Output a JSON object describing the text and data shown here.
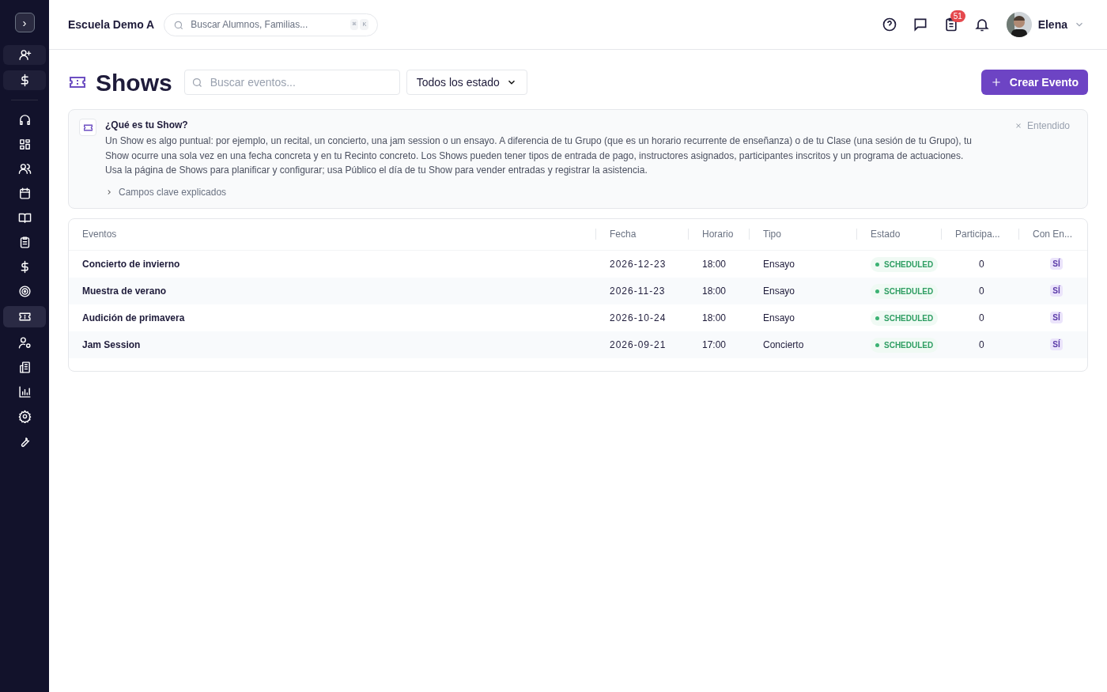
{
  "sidebar": {
    "toggle": "›",
    "items": [
      {
        "kind": "quick",
        "selected": false
      },
      {
        "kind": "quick",
        "selected": false
      },
      {
        "kind": "nav",
        "selected": false
      },
      {
        "kind": "nav",
        "selected": false
      },
      {
        "kind": "nav",
        "selected": false
      },
      {
        "kind": "nav",
        "selected": false
      },
      {
        "kind": "nav",
        "selected": false
      },
      {
        "kind": "nav",
        "selected": false
      },
      {
        "kind": "nav",
        "selected": false
      },
      {
        "kind": "nav",
        "selected": false
      },
      {
        "kind": "nav",
        "selected": true
      },
      {
        "kind": "nav",
        "selected": false
      },
      {
        "kind": "nav",
        "selected": false
      },
      {
        "kind": "nav",
        "selected": false
      },
      {
        "kind": "nav",
        "selected": false
      },
      {
        "kind": "nav",
        "selected": false
      }
    ]
  },
  "header": {
    "school": "Escuela Demo A",
    "search": {
      "placeholder": "Buscar Alumnos, Familias...",
      "keys": [
        "⌘",
        "K"
      ]
    },
    "tasks_badge": "51",
    "user": "Elena"
  },
  "page": {
    "title": "Shows",
    "search": {
      "placeholder": "Buscar eventos..."
    },
    "status_filter": "Todos los estado",
    "create_button": "Crear Evento"
  },
  "info": {
    "title": "¿Qué es tu Show?",
    "body": "Un Show es algo puntual: por ejemplo, un recital, un concierto, una jam session o un ensayo. A diferencia de tu Grupo (que es un horario recurrente de enseñanza) o de tu Clase (una sesión de tu Grupo), tu Show ocurre una sola vez en una fecha concreta y en tu Recinto concreto. Los Shows pueden tener tipos de entrada de pago, instructores asignados, participantes inscritos y un programa de actuaciones. Usa la página de Shows para planificar y configurar; usa Público el día de tu Show para vender entradas y registrar la asistencia.",
    "details": "Campos clave explicados",
    "dismiss": "Entendido"
  },
  "table": {
    "columns": [
      "Eventos",
      "Fecha",
      "Horario",
      "Tipo",
      "Estado",
      "Participa...",
      "Con En..."
    ],
    "rows": [
      {
        "name": "Concierto de invierno",
        "date": "2026-12-23",
        "time": "18:00",
        "type": "Ensayo",
        "status": "SCHEDULED",
        "participants": "0",
        "tickets": "SÍ"
      },
      {
        "name": "Muestra de verano",
        "date": "2026-11-23",
        "time": "18:00",
        "type": "Ensayo",
        "status": "SCHEDULED",
        "participants": "0",
        "tickets": "SÍ"
      },
      {
        "name": "Audición de primavera",
        "date": "2026-10-24",
        "time": "18:00",
        "type": "Ensayo",
        "status": "SCHEDULED",
        "participants": "0",
        "tickets": "SÍ"
      },
      {
        "name": "Jam Session",
        "date": "2026-09-21",
        "time": "17:00",
        "type": "Concierto",
        "status": "SCHEDULED",
        "participants": "0",
        "tickets": "SÍ"
      }
    ]
  }
}
